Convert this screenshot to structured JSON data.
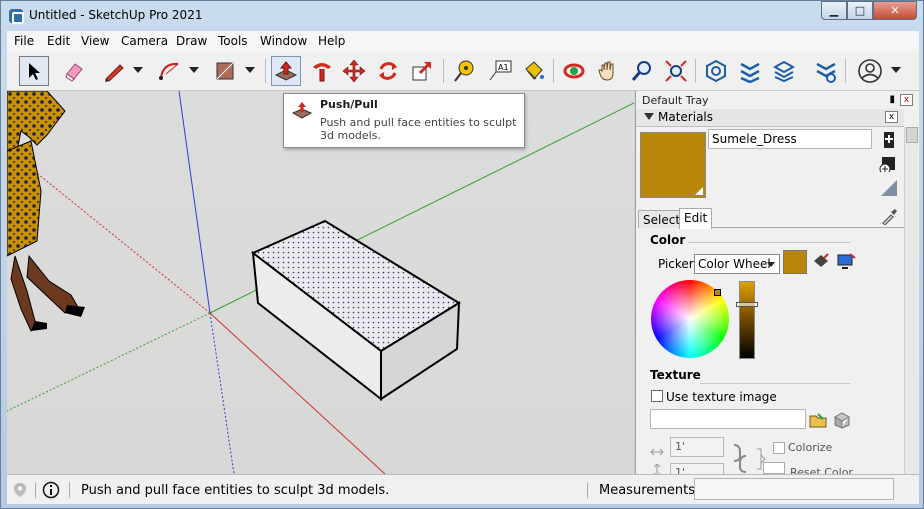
{
  "window": {
    "title": "Untitled - SketchUp Pro 2021",
    "minimize": "▁",
    "maximize": "□",
    "close": "✕"
  },
  "menu": [
    "File",
    "Edit",
    "View",
    "Camera",
    "Draw",
    "Tools",
    "Window",
    "Help"
  ],
  "toolbar": {
    "tools": [
      "select-tool",
      "eraser-tool",
      "line-tool",
      "arc-tool",
      "shape-tool",
      "push-pull-tool",
      "follow-me-tool",
      "move-tool",
      "rotate-tool",
      "scale-tool",
      "tape-measure-tool",
      "text-tool",
      "paint-bucket-tool",
      "orbit-tool",
      "pan-tool",
      "zoom-tool",
      "zoom-extents-tool",
      "3d-warehouse",
      "extension-warehouse",
      "layout",
      "extension-manager",
      "account"
    ],
    "active_tool": "push-pull-tool",
    "text_tool_label": "A1"
  },
  "tooltip": {
    "title": "Push/Pull",
    "description": "Push and pull face entities to sculpt 3d models."
  },
  "tray": {
    "title": "Default Tray",
    "pin": "▮",
    "close": "x",
    "materials": {
      "header": "Materials",
      "close": "x",
      "material_name": "Sumele_Dress",
      "swatch_color": "#b8860b",
      "tabs": {
        "select": "Select",
        "edit": "Edit",
        "active": "Edit"
      },
      "color": {
        "section": "Color",
        "picker_label": "Picker:",
        "picker_value": "Color Wheel"
      },
      "texture": {
        "section": "Texture",
        "use_texture_label": "Use texture image",
        "use_texture_checked": false,
        "path": "",
        "width": "1'",
        "height": "1'",
        "colorize_label": "Colorize",
        "reset_color_label": "Reset Color"
      }
    }
  },
  "status": {
    "message": "Push and pull face entities to sculpt 3d models.",
    "measurements_label": "Measurements",
    "measurements_value": ""
  },
  "colors": {
    "axis_red": "#d03030",
    "axis_green": "#2fa52f",
    "axis_blue": "#2f3fd0",
    "material": "#b8860b"
  }
}
